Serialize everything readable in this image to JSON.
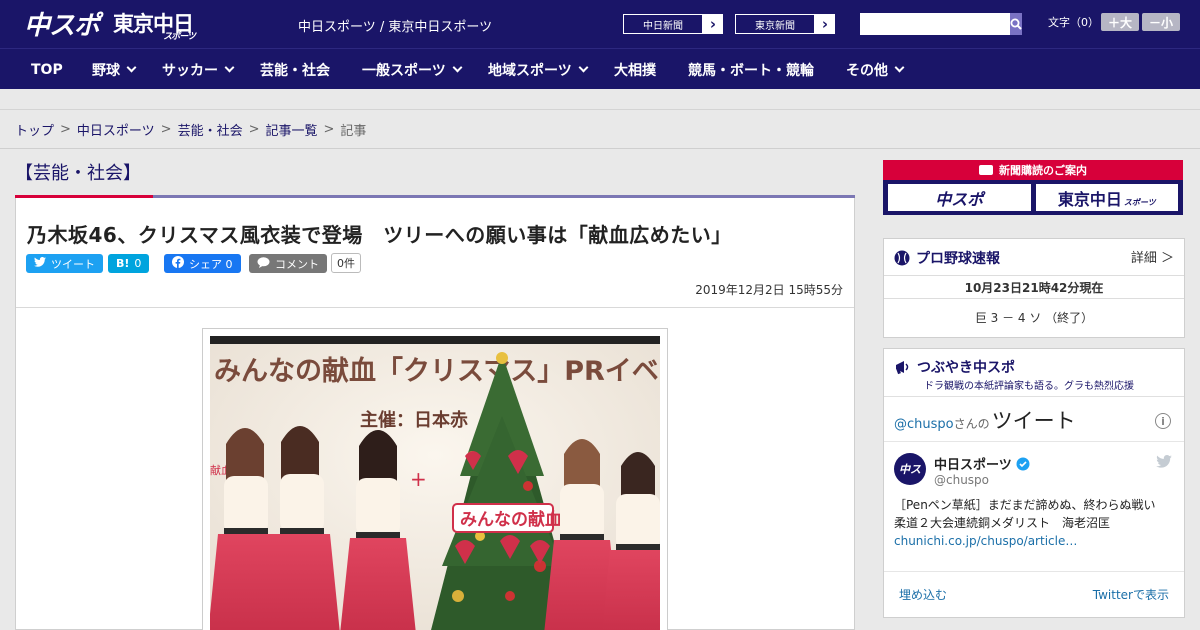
{
  "header": {
    "logo_chuspo": "中スポ",
    "logo_tokyo": "東京中日",
    "logo_tokyo_sub": "スポーツ",
    "site_name": "中日スポーツ / 東京中日スポーツ",
    "paper_links": [
      {
        "label": "中日新聞"
      },
      {
        "label": "東京新聞"
      }
    ],
    "search": {
      "placeholder": ""
    },
    "font_size_label": "文字（0）",
    "font_bigger": "＋大",
    "font_smaller": "－小"
  },
  "nav": [
    {
      "label": "TOP",
      "has_menu": false
    },
    {
      "label": "野球",
      "has_menu": true
    },
    {
      "label": "サッカー",
      "has_menu": true
    },
    {
      "label": "芸能・社会",
      "has_menu": false
    },
    {
      "label": "一般スポーツ",
      "has_menu": true
    },
    {
      "label": "地域スポーツ",
      "has_menu": true
    },
    {
      "label": "大相撲",
      "has_menu": false
    },
    {
      "label": "競馬・ボート・競輪",
      "has_menu": false
    },
    {
      "label": "その他",
      "has_menu": true
    }
  ],
  "breadcrumb": {
    "items": [
      "トップ",
      "中日スポーツ",
      "芸能・社会",
      "記事一覧"
    ],
    "current": "記事",
    "sep": ">"
  },
  "article": {
    "category": "【芸能・社会】",
    "headline": "乃木坂46、クリスマス風衣装で登場　ツリーへの願い事は「献血広めたい」",
    "share": {
      "tweet": "ツイート",
      "hatena_icon": "B!",
      "hatena_count": "0",
      "facebook": "シェア 0",
      "comment": "コメント",
      "comment_count": "0件"
    },
    "date": "2019年12月2日 15時55分",
    "photo": {
      "banner_text": "みんなの献血「クリスマス」PRイベント",
      "sponsor_text": "主催：日本赤",
      "sign_text": "みんなの献血"
    }
  },
  "sidebar": {
    "subscribe": {
      "title": "新聞購読のご案内",
      "chuspo": "中スポ",
      "tokyo": "東京中日",
      "tokyo_sub": "スポーツ"
    },
    "baseball": {
      "title": "プロ野球速報",
      "detail": "詳細 ＞",
      "as_of": "10月23日21時42分現在",
      "score": "巨 3 － 4 ソ （終了）"
    },
    "twitter": {
      "title": "つぶやき中スポ",
      "subtitle": "ドラ観戦の本紙評論家も語る。グラも熱烈応援",
      "handle_prefix": "@chuspo",
      "handle_suffix": "さんの",
      "tweets_label": "ツイート",
      "account_name": "中日スポーツ",
      "account_handle": "@chuspo",
      "tweet_text_1": "［Penペン草紙］まだまだ諦めぬ、終わらぬ戦い",
      "tweet_text_2": "柔道２大会連続銅メダリスト　海老沼匡",
      "tweet_link": "chunichi.co.jp/chuspo/article…",
      "embed": "埋め込む",
      "view_on_twitter": "Twitterで表示"
    }
  },
  "colors": {
    "brand_navy": "#1a1568",
    "accent_red": "#d7003a",
    "twitter": "#1da1f2",
    "hatena": "#00a4de",
    "facebook": "#1877f2",
    "comment": "#777777"
  }
}
